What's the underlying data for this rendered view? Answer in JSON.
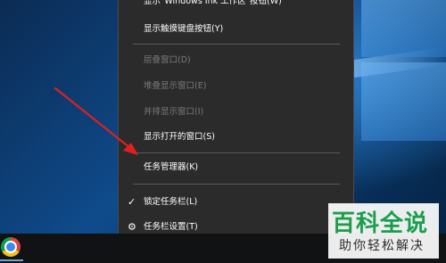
{
  "context_menu": {
    "items": [
      {
        "label": "显示\"Windows Ink 工作区\"按钮(W)",
        "enabled": true
      },
      {
        "label": "显示触摸键盘按钮(Y)",
        "enabled": true
      },
      {
        "label": "层叠窗口(D)",
        "enabled": false
      },
      {
        "label": "堆叠显示窗口(E)",
        "enabled": false
      },
      {
        "label": "并排显示窗口(I)",
        "enabled": false
      },
      {
        "label": "显示打开的窗口(S)",
        "enabled": true
      },
      {
        "label": "任务管理器(K)",
        "enabled": true
      },
      {
        "label": "锁定任务栏(L)",
        "enabled": true,
        "checked": true,
        "icon": "checkmark-icon"
      },
      {
        "label": "任务栏设置(T)",
        "enabled": true,
        "icon": "gear-icon"
      }
    ]
  },
  "annotation": {
    "arrow_color": "#e02020",
    "points_to": "任务管理器(K)"
  },
  "taskbar": {
    "pinned": [
      {
        "name": "Google Chrome",
        "icon": "chrome-icon"
      }
    ]
  },
  "watermark": {
    "title": "百科全说",
    "subtitle": "助你轻松解决",
    "color": "#1b9e4b"
  }
}
